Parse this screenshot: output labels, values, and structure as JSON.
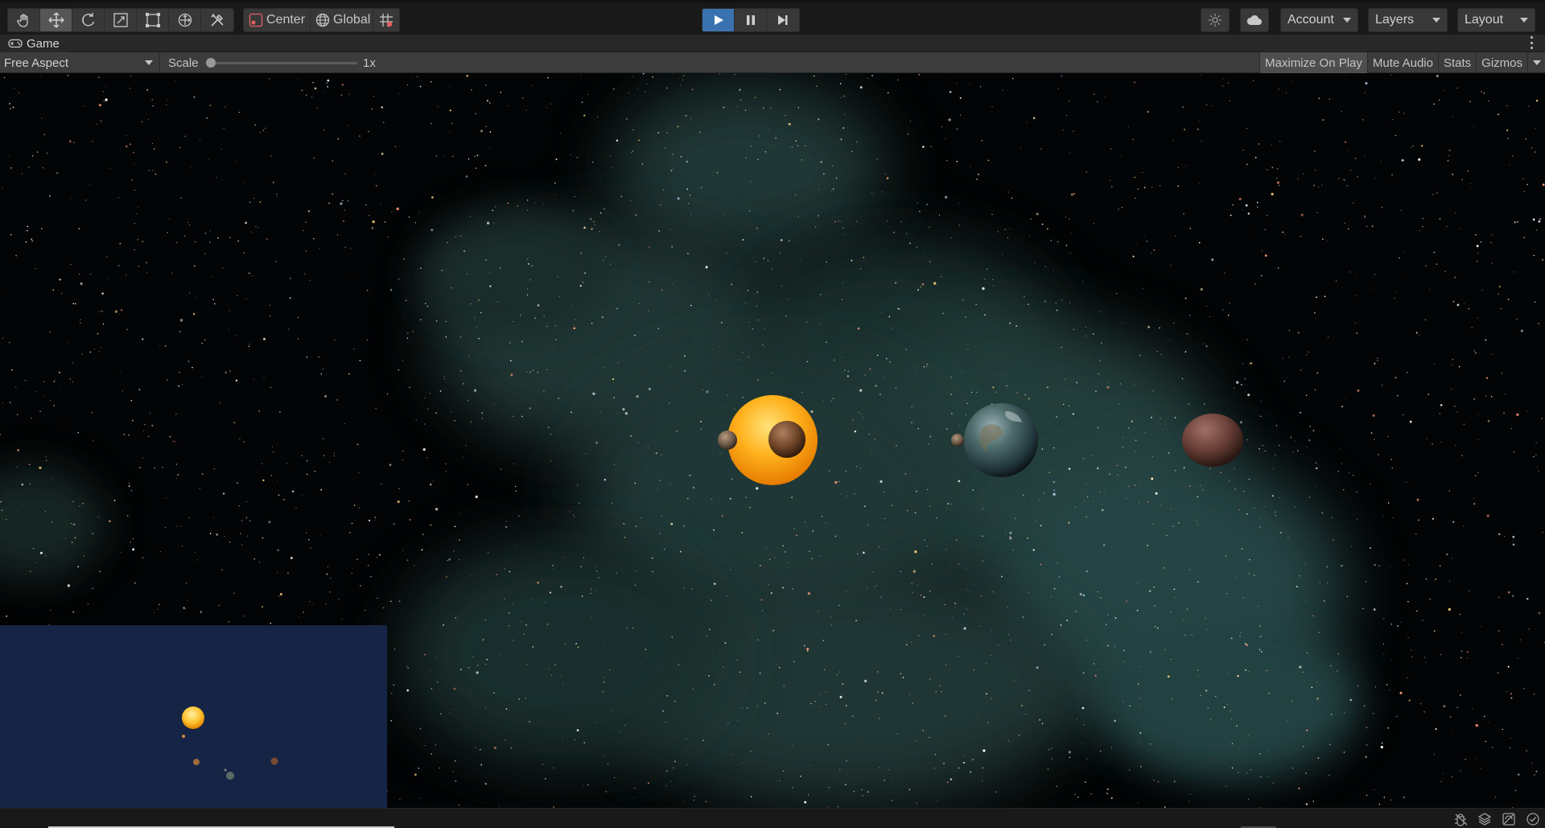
{
  "toolbar": {
    "tools": [
      {
        "name": "hand-tool",
        "icon": "hand-icon",
        "active": false
      },
      {
        "name": "move-tool",
        "icon": "move-icon",
        "active": true
      },
      {
        "name": "rotate-tool",
        "icon": "rotate-icon",
        "active": false
      },
      {
        "name": "scale-tool",
        "icon": "scale-icon",
        "active": false
      },
      {
        "name": "rect-tool",
        "icon": "rect-transform-icon",
        "active": false
      },
      {
        "name": "transform-tool",
        "icon": "transform-icon",
        "active": false
      },
      {
        "name": "custom-tool",
        "icon": "tools-icon",
        "active": false
      }
    ],
    "pivot_label": "Center",
    "space_label": "Global",
    "play_mode": "playing",
    "account_label": "Account",
    "layers_label": "Layers",
    "layout_label": "Layout",
    "accent_color": "#3a72b0"
  },
  "tab": {
    "title": "Game"
  },
  "gamebar": {
    "aspect_label": "Free Aspect",
    "scale_label": "Scale",
    "scale_value": "1x",
    "scale_fraction": 0.0,
    "buttons": {
      "maximize": "Maximize On Play",
      "mute": "Mute Audio",
      "stats": "Stats",
      "gizmos": "Gizmos"
    },
    "maximize_active": true
  },
  "scene": {
    "background": "starfield-nebula",
    "bodies": [
      "sun",
      "mercury",
      "venus",
      "earth",
      "moon",
      "mars"
    ],
    "minimap_background": "#162545"
  },
  "statusbar": {
    "icons": [
      "debug-icon",
      "layers-icon",
      "visibility-icon",
      "check-circle-icon"
    ]
  }
}
